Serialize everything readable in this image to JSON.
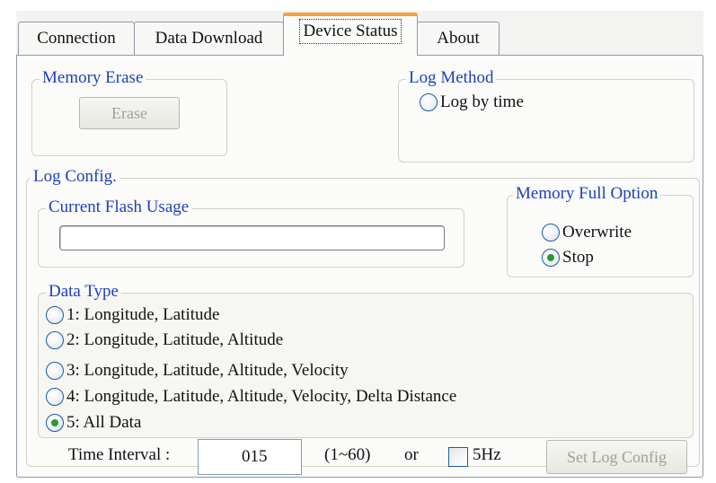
{
  "tabs": [
    {
      "label": "Connection"
    },
    {
      "label": "Data Download"
    },
    {
      "label": "Device Status"
    },
    {
      "label": "About"
    }
  ],
  "memory_erase": {
    "title": "Memory Erase",
    "erase_button": "Erase"
  },
  "log_method": {
    "title": "Log Method",
    "options": [
      {
        "label": "Log by time",
        "checked": false
      }
    ]
  },
  "log_config": {
    "title": "Log Config.",
    "flash_usage": {
      "title": "Current Flash Usage",
      "percent": 0
    },
    "memory_full": {
      "title": "Memory Full Option",
      "options": [
        {
          "label": "Overwrite",
          "checked": false
        },
        {
          "label": "Stop",
          "checked": true
        }
      ]
    },
    "data_type": {
      "title": "Data Type",
      "options": [
        {
          "label": "1: Longitude, Latitude",
          "checked": false
        },
        {
          "label": "2: Longitude, Latitude, Altitude",
          "checked": false
        },
        {
          "label": "3: Longitude, Latitude, Altitude, Velocity",
          "checked": false
        },
        {
          "label": "4: Longitude, Latitude, Altitude, Velocity, Delta Distance",
          "checked": false
        },
        {
          "label": "5: All Data",
          "checked": true
        }
      ]
    },
    "time_interval": {
      "label": "Time Interval :",
      "value": "015",
      "range": "(1~60)",
      "or": "or",
      "hz_label": "5Hz",
      "hz_checked": false
    },
    "set_button": "Set Log Config"
  }
}
